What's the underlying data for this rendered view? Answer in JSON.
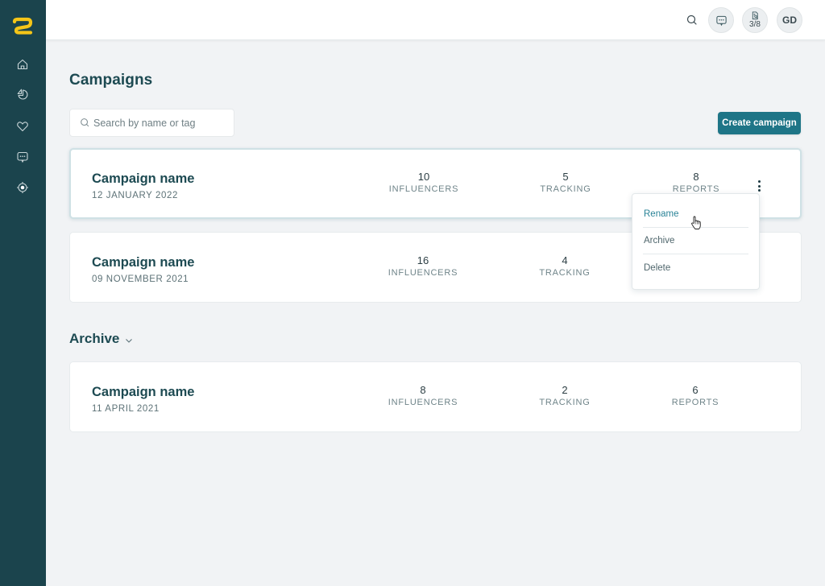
{
  "sidebar": {
    "brand_color": "#f5c518",
    "background": "#1b444d",
    "items": [
      {
        "name": "home",
        "icon": "home-icon"
      },
      {
        "name": "analytics",
        "icon": "pie-chart-icon"
      },
      {
        "name": "favorites",
        "icon": "heart-icon"
      },
      {
        "name": "messages",
        "icon": "chat-icon"
      },
      {
        "name": "tracking",
        "icon": "target-icon"
      }
    ]
  },
  "topbar": {
    "search_icon": "search-icon",
    "chat_icon": "chat-icon",
    "reports_icon": "document-search-icon",
    "reports_count": "3/8",
    "avatar_initials": "GD"
  },
  "page": {
    "title": "Campaigns",
    "search_placeholder": "Search by name or tag",
    "search_value": "",
    "create_button_label": "Create campaign",
    "accent_color": "#1e7587"
  },
  "campaigns": [
    {
      "name": "Campaign name",
      "date": "12 JANUARY 2022",
      "stats": [
        {
          "value": "10",
          "label": "INFLUENCERS"
        },
        {
          "value": "5",
          "label": "TRACKING"
        },
        {
          "value": "8",
          "label": "REPORTS"
        }
      ]
    },
    {
      "name": "Campaign name",
      "date": "09 NOVEMBER 2021",
      "stats": [
        {
          "value": "16",
          "label": "INFLUENCERS"
        },
        {
          "value": "4",
          "label": "TRACKING"
        }
      ]
    }
  ],
  "context_menu": {
    "items": [
      {
        "label": "Rename"
      },
      {
        "label": "Archive"
      },
      {
        "label": "Delete"
      }
    ],
    "hovered": "Rename"
  },
  "archive": {
    "heading": "Archive",
    "campaigns": [
      {
        "name": "Campaign name",
        "date": "11 APRIL 2021",
        "stats": [
          {
            "value": "8",
            "label": "INFLUENCERS"
          },
          {
            "value": "2",
            "label": "TRACKING"
          },
          {
            "value": "6",
            "label": "REPORTS"
          }
        ]
      }
    ]
  }
}
